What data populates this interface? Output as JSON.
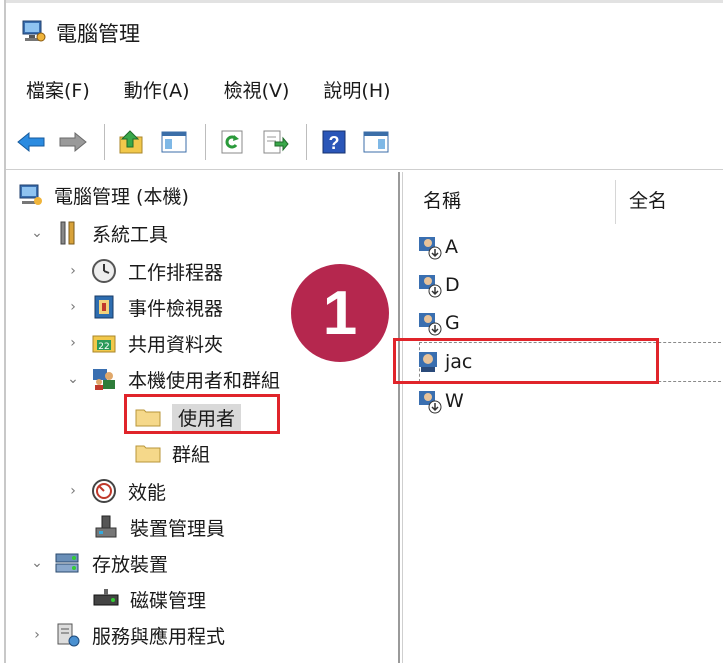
{
  "window": {
    "title": "電腦管理"
  },
  "menu": [
    "檔案(F)",
    "動作(A)",
    "檢視(V)",
    "說明(H)"
  ],
  "toolbar": {
    "buttons": [
      "back-icon",
      "forward-icon",
      "up-folder-icon",
      "show-tree-icon",
      "refresh-icon",
      "export-list-icon",
      "help-icon",
      "action-pane-icon"
    ]
  },
  "tree": [
    {
      "label": "電腦管理 (本機)",
      "icon": "computer-management-icon"
    },
    {
      "label": "系統工具",
      "icon": "tools-icon",
      "expanded": true
    },
    {
      "label": "工作排程器",
      "icon": "clock-icon",
      "expanded": false
    },
    {
      "label": "事件檢視器",
      "icon": "event-viewer-icon",
      "expanded": false
    },
    {
      "label": "共用資料夾",
      "icon": "shared-folder-icon",
      "expanded": false
    },
    {
      "label": "本機使用者和群組",
      "icon": "users-groups-icon",
      "expanded": true
    },
    {
      "label": "使用者",
      "icon": "folder-icon",
      "selected": true
    },
    {
      "label": "群組",
      "icon": "folder-icon"
    },
    {
      "label": "效能",
      "icon": "performance-icon",
      "expanded": false
    },
    {
      "label": "裝置管理員",
      "icon": "device-manager-icon"
    },
    {
      "label": "存放裝置",
      "icon": "storage-icon",
      "expanded": true
    },
    {
      "label": "磁碟管理",
      "icon": "disk-icon"
    },
    {
      "label": "服務與應用程式",
      "icon": "services-icon",
      "expanded": false
    }
  ],
  "list": {
    "columns": [
      "名稱",
      "全名"
    ],
    "rows": [
      "A",
      "D",
      "G",
      "jac",
      "W"
    ],
    "selected_index": 3
  },
  "annotation": {
    "step": "1"
  },
  "colors": {
    "callout": "#e0242a",
    "badge": "#b5274e"
  }
}
